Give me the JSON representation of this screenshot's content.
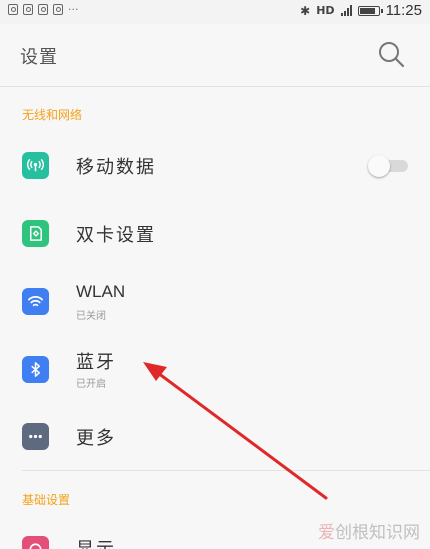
{
  "status_bar": {
    "more": "···",
    "bluetooth": "✱",
    "network": "HD",
    "time": "11:25"
  },
  "header": {
    "title": "设置",
    "search_icon": "search-icon"
  },
  "sections": {
    "network": {
      "label": "无线和网络"
    },
    "basic": {
      "label": "基础设置"
    }
  },
  "rows": {
    "mobile_data": {
      "title": "移动数据",
      "icon": "antenna-icon",
      "color": "#26bfa0",
      "toggle_on": false
    },
    "dual_sim": {
      "title": "双卡设置",
      "icon": "sim-card-icon",
      "color": "#2fc47e"
    },
    "wlan": {
      "title": "WLAN",
      "subtitle": "已关闭",
      "icon": "wifi-icon",
      "color": "#3f7ff2"
    },
    "bluetooth": {
      "title": "蓝牙",
      "subtitle": "已开启",
      "icon": "bluetooth-icon",
      "color": "#3f7ff2"
    },
    "more": {
      "title": "更多",
      "icon": "more-icon",
      "color": "#5d6a80"
    },
    "display": {
      "title": "显示",
      "icon": "display-icon",
      "color": "#e54e78"
    }
  },
  "annotation": {
    "arrow_color": "#e02828"
  },
  "watermark": {
    "brand_a": "爱",
    "brand_b": "创根",
    "brand_c": "知识网"
  }
}
